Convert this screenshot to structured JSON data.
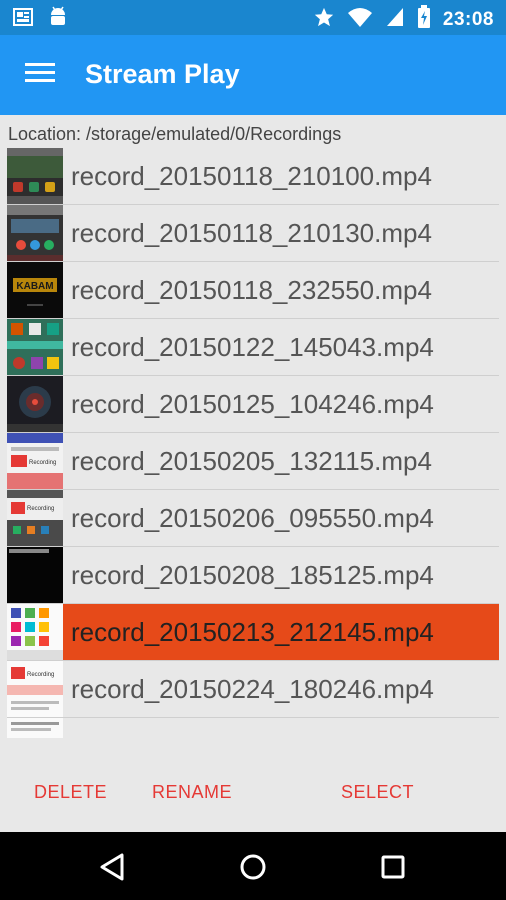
{
  "status_bar": {
    "time": "23:08",
    "icons": [
      "screen-cast-icon",
      "android-icon",
      "star-icon",
      "wifi-icon",
      "signal-icon",
      "battery-charging-icon"
    ]
  },
  "app_bar": {
    "title": "Stream Play",
    "menu_icon": "hamburger-menu-icon"
  },
  "location": "Location: /storage/emulated/0/Recordings",
  "files": [
    {
      "name": "record_20150118_210100.mp4",
      "selected": false
    },
    {
      "name": "record_20150118_210130.mp4",
      "selected": false
    },
    {
      "name": "record_20150118_232550.mp4",
      "selected": false
    },
    {
      "name": "record_20150122_145043.mp4",
      "selected": false
    },
    {
      "name": "record_20150125_104246.mp4",
      "selected": false
    },
    {
      "name": "record_20150205_132115.mp4",
      "selected": false
    },
    {
      "name": "record_20150206_095550.mp4",
      "selected": false
    },
    {
      "name": "record_20150208_185125.mp4",
      "selected": false
    },
    {
      "name": "record_20150213_212145.mp4",
      "selected": true
    },
    {
      "name": "record_20150224_180246.mp4",
      "selected": false
    }
  ],
  "thumb_text": {
    "kabam": "KABAM",
    "recording_a": "Recording",
    "recording_b": "Recording",
    "recording_c": "Recording"
  },
  "actions": {
    "delete": "DELETE",
    "rename": "RENAME",
    "select": "SELECT"
  },
  "nav_bar": {
    "icons": [
      "back-icon",
      "home-icon",
      "recents-icon"
    ]
  },
  "colors": {
    "status_bar": "#1a86cf",
    "app_bar": "#2196f3",
    "selected_row": "#e64a19",
    "action_text": "#e53935",
    "background": "#e8e8e8"
  }
}
